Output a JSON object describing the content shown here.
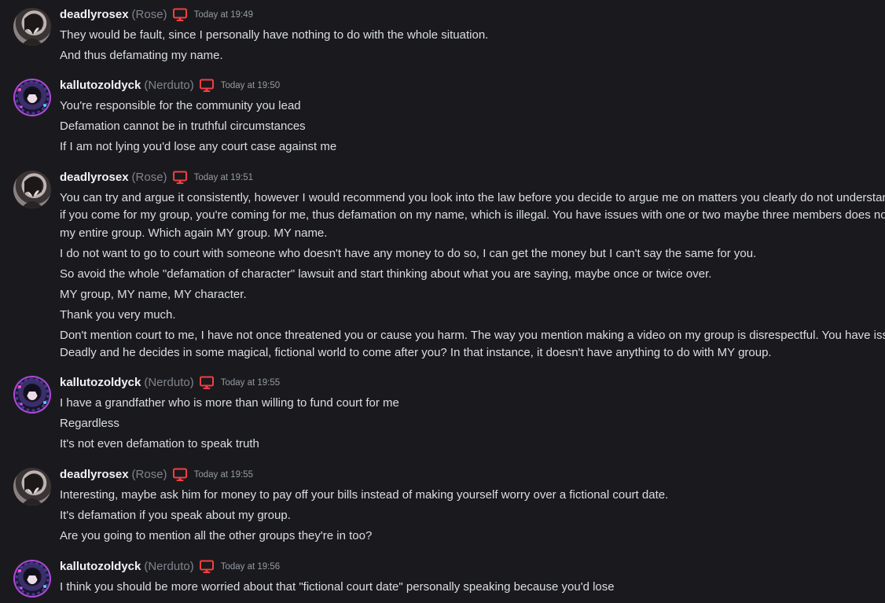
{
  "colors": {
    "background": "#1a1a1e",
    "username": "#f2f3f5",
    "nickname": "#80848e",
    "timestamp": "#949ba4",
    "message_text": "#dbdee1",
    "device_icon": "#f23f43"
  },
  "groups": [
    {
      "username": "deadlyrosex",
      "nickname": "(Rose)",
      "device_icon": "monitor-icon",
      "timestamp": "Today at 19:49",
      "messages": [
        "They would be fault, since I personally have nothing to do with the whole situation.",
        "And thus defamating my name."
      ]
    },
    {
      "username": "kallutozoldyck",
      "nickname": "(Nerduto)",
      "device_icon": "monitor-icon",
      "timestamp": "Today at 19:50",
      "messages": [
        "You're responsible for the community you lead",
        "Defamation cannot be in truthful circumstances",
        "If I am not lying you'd lose any court case against me"
      ]
    },
    {
      "username": "deadlyrosex",
      "nickname": "(Rose)",
      "device_icon": "monitor-icon",
      "timestamp": "Today at 19:51",
      "messages": [
        "You can try and argue it consistently, however I would recommend you look into the law before you decide to argue me on matters you clearly do not understand. Again, if you come for my group, you're coming for me, thus defamation on my name, which is illegal. You have issues with one or two maybe three members does not mean my entire group. Which again MY group. MY name.",
        "I do not want to go to court with someone who doesn't have any money to do so, I can get the money but I can't say the same for you.",
        "So avoid the whole \"defamation of character\" lawsuit and start thinking about what you are saying, maybe once or twice over.",
        "MY group, MY name, MY character.",
        "Thank you very much.",
        "Don't mention court to me, I have not once threatened you or cause you harm. The way you mention making a video on my group is disrespectful. You have issues with Deadly and he decides in some magical, fictional world to come after you? In that instance, it doesn't have anything to do with MY group."
      ]
    },
    {
      "username": "kallutozoldyck",
      "nickname": "(Nerduto)",
      "device_icon": "monitor-icon",
      "timestamp": "Today at 19:55",
      "messages": [
        "I have a grandfather who is more than willing to fund court for me",
        "Regardless",
        "It's not even defamation to speak truth"
      ]
    },
    {
      "username": "deadlyrosex",
      "nickname": "(Rose)",
      "device_icon": "monitor-icon",
      "timestamp": "Today at 19:55",
      "messages": [
        "Interesting, maybe ask him for money to pay off your bills instead of making yourself worry over a fictional court date.",
        "It's defamation if you speak about my group.",
        "Are you going to mention all the other groups they're in too?"
      ]
    },
    {
      "username": "kallutozoldyck",
      "nickname": "(Nerduto)",
      "device_icon": "monitor-icon",
      "timestamp": "Today at 19:56",
      "messages": [
        "I think you should be more worried about that \"fictional court date\" personally speaking because you'd lose"
      ]
    }
  ]
}
